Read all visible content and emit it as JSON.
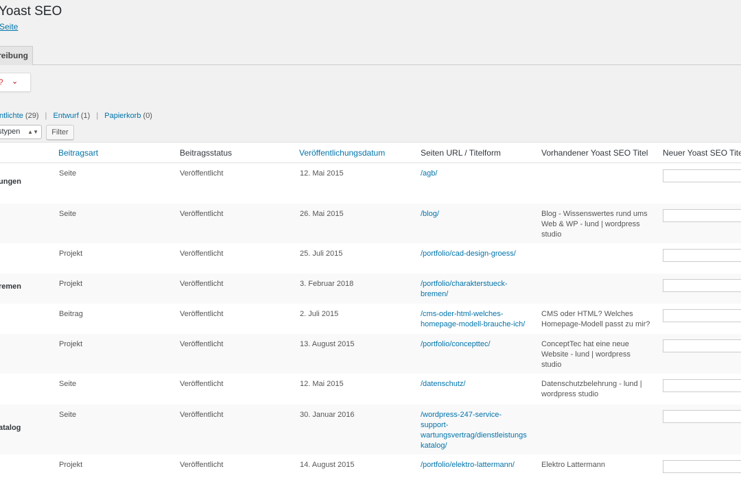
{
  "header": {
    "title": "Yoast SEO",
    "link": "Seite"
  },
  "tab": {
    "label": "reibung"
  },
  "help": {
    "question": "?",
    "chevron": "⌄"
  },
  "filters": {
    "published": {
      "label": "ntlichte",
      "count": "(29)"
    },
    "draft": {
      "label": "Entwurf",
      "count": "(1)"
    },
    "trash": {
      "label": "Papierkorb",
      "count": "(0)"
    },
    "separator": "|",
    "type_select": "stypen",
    "filter_button": "Filter"
  },
  "table": {
    "headers": [
      "Beitragsart",
      "Beitragsstatus",
      "Veröffentlichungsdatum",
      "Seiten URL / Titelform",
      "Vorhandener Yoast SEO Titel",
      "Neuer Yoast SEO Titel"
    ],
    "rows": [
      {
        "title": "ungen",
        "type": "Seite",
        "status": "Veröffentlicht",
        "date": "12. Mai 2015",
        "url": [
          "/agb/"
        ],
        "existing": []
      },
      {
        "title": "",
        "type": "Seite",
        "status": "Veröffentlicht",
        "date": "26. Mai 2015",
        "url": [
          "/blog/"
        ],
        "existing": [
          "Blog - Wissenswertes rund ums",
          "Web & WP - lund | wordpress",
          "studio"
        ]
      },
      {
        "title": "",
        "type": "Projekt",
        "status": "Veröffentlicht",
        "date": "25. Juli 2015",
        "url": [
          "/portfolio/cad-design-groess/"
        ],
        "existing": []
      },
      {
        "title": "remen",
        "type": "Projekt",
        "status": "Veröffentlicht",
        "date": "3. Februar 2018",
        "url": [
          "/portfolio/charakterstueck-",
          "bremen/"
        ],
        "existing": []
      },
      {
        "title": "",
        "type": "Beitrag",
        "status": "Veröffentlicht",
        "date": "2. Juli 2015",
        "url": [
          "/cms-oder-html-welches-",
          "homepage-modell-brauche-ich/"
        ],
        "existing": [
          "CMS oder HTML? Welches",
          "Homepage-Modell passt zu mir?"
        ]
      },
      {
        "title": "",
        "type": "Projekt",
        "status": "Veröffentlicht",
        "date": "13. August 2015",
        "url": [
          "/portfolio/concepttec/"
        ],
        "existing": [
          "ConceptTec hat eine neue",
          "Website - lund | wordpress",
          "studio"
        ]
      },
      {
        "title": "",
        "type": "Seite",
        "status": "Veröffentlicht",
        "date": "12. Mai 2015",
        "url": [
          "/datenschutz/"
        ],
        "existing": [
          "Datenschutzbelehrung - lund |",
          "wordpress studio"
        ]
      },
      {
        "title": "atalog",
        "type": "Seite",
        "status": "Veröffentlicht",
        "date": "30. Januar 2016",
        "url": [
          "/wordpress-247-service-",
          "support-",
          "wartungsvertrag/dienstleistungs",
          "katalog/"
        ],
        "existing": []
      },
      {
        "title": "",
        "type": "Projekt",
        "status": "Veröffentlicht",
        "date": "14. August 2015",
        "url": [
          "/portfolio/elektro-lattermann/"
        ],
        "existing": [
          "Elektro Lattermann"
        ]
      }
    ]
  }
}
